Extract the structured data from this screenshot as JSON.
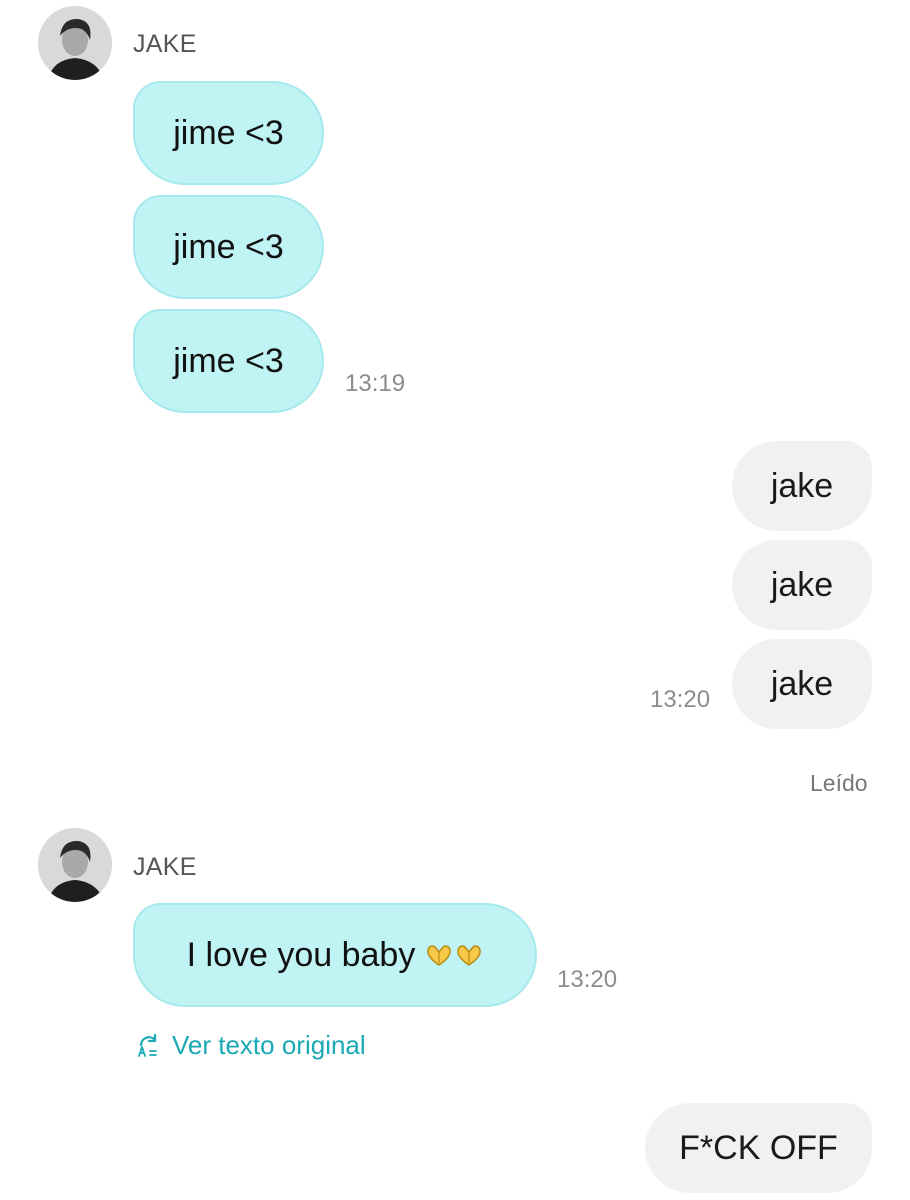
{
  "conversation": {
    "contact_name": "JAKE",
    "group1": {
      "messages": [
        "jime <3",
        "jime <3",
        "jime <3"
      ],
      "time": "13:19"
    },
    "group2": {
      "messages": [
        "jake",
        "jake",
        "jake"
      ],
      "time": "13:20",
      "status": "Leído"
    },
    "group3": {
      "message": "I love you baby",
      "emoji_icon": "heart-hands-icon",
      "time": "13:20",
      "translate_link": "Ver texto original"
    },
    "group4": {
      "message": "F*CK OFF"
    }
  },
  "colors": {
    "incoming_bubble": "#bff3f4",
    "outgoing_bubble": "#f1f1f4",
    "accent_link": "#1aa9b5"
  }
}
